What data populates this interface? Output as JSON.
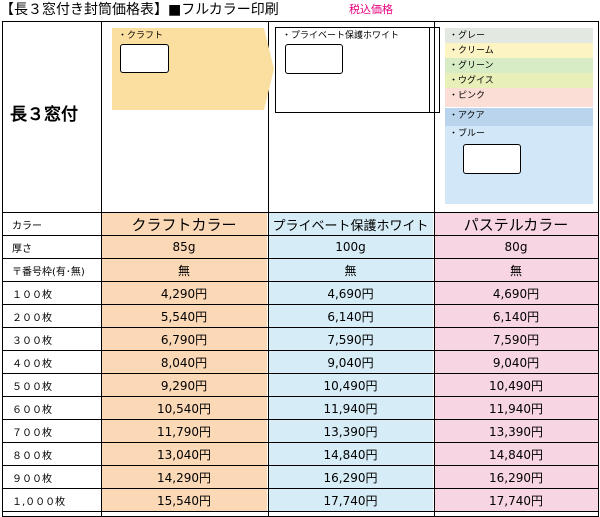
{
  "header": {
    "title": "【長３窓付き封筒価格表】■フルカラー印刷",
    "tax_note": "税込価格"
  },
  "section_label": "長３窓付",
  "envelopes": {
    "kraft": {
      "label": "・クラフト",
      "color": "#fbdfa0"
    },
    "private": {
      "label": "・プライベート保護ホワイト"
    },
    "pastel": [
      {
        "label": "・グレー",
        "color": "#e3e8e0"
      },
      {
        "label": "・クリーム",
        "color": "#fdf4c4"
      },
      {
        "label": "・グリーン",
        "color": "#d7ebc4"
      },
      {
        "label": "・ウグイス",
        "color": "#e9efb8"
      },
      {
        "label": "・ピンク",
        "color": "#fbdfd6"
      },
      {
        "label": "・アクア",
        "color": "#b9d4ec"
      },
      {
        "label": "・ブルー",
        "color": "#d2e8f8"
      }
    ]
  },
  "table": {
    "header": {
      "label": "カラー",
      "cols": [
        "クラフトカラー",
        "プライベート保護ホワイト",
        "パステルカラー"
      ]
    },
    "thickness": {
      "label": "厚さ",
      "cols": [
        "85g",
        "100g",
        "80g"
      ]
    },
    "postal": {
      "label": "〒番号枠(有･無)",
      "cols": [
        "無",
        "無",
        "無"
      ]
    },
    "rows": [
      {
        "qty": "１００枚",
        "prices": [
          "4,290円",
          "4,690円",
          "4,690円"
        ]
      },
      {
        "qty": "２００枚",
        "prices": [
          "5,540円",
          "6,140円",
          "6,140円"
        ]
      },
      {
        "qty": "３００枚",
        "prices": [
          "6,790円",
          "7,590円",
          "7,590円"
        ]
      },
      {
        "qty": "４００枚",
        "prices": [
          "8,040円",
          "9,040円",
          "9,040円"
        ]
      },
      {
        "qty": "５００枚",
        "prices": [
          "9,290円",
          "10,490円",
          "10,490円"
        ]
      },
      {
        "qty": "６００枚",
        "prices": [
          "10,540円",
          "11,940円",
          "11,940円"
        ]
      },
      {
        "qty": "７００枚",
        "prices": [
          "11,790円",
          "13,390円",
          "13,390円"
        ]
      },
      {
        "qty": "８００枚",
        "prices": [
          "13,040円",
          "14,840円",
          "14,840円"
        ]
      },
      {
        "qty": "９００枚",
        "prices": [
          "14,290円",
          "16,290円",
          "16,290円"
        ]
      },
      {
        "qty": "１,０００枚",
        "prices": [
          "15,540円",
          "17,740円",
          "17,740円"
        ]
      }
    ]
  }
}
